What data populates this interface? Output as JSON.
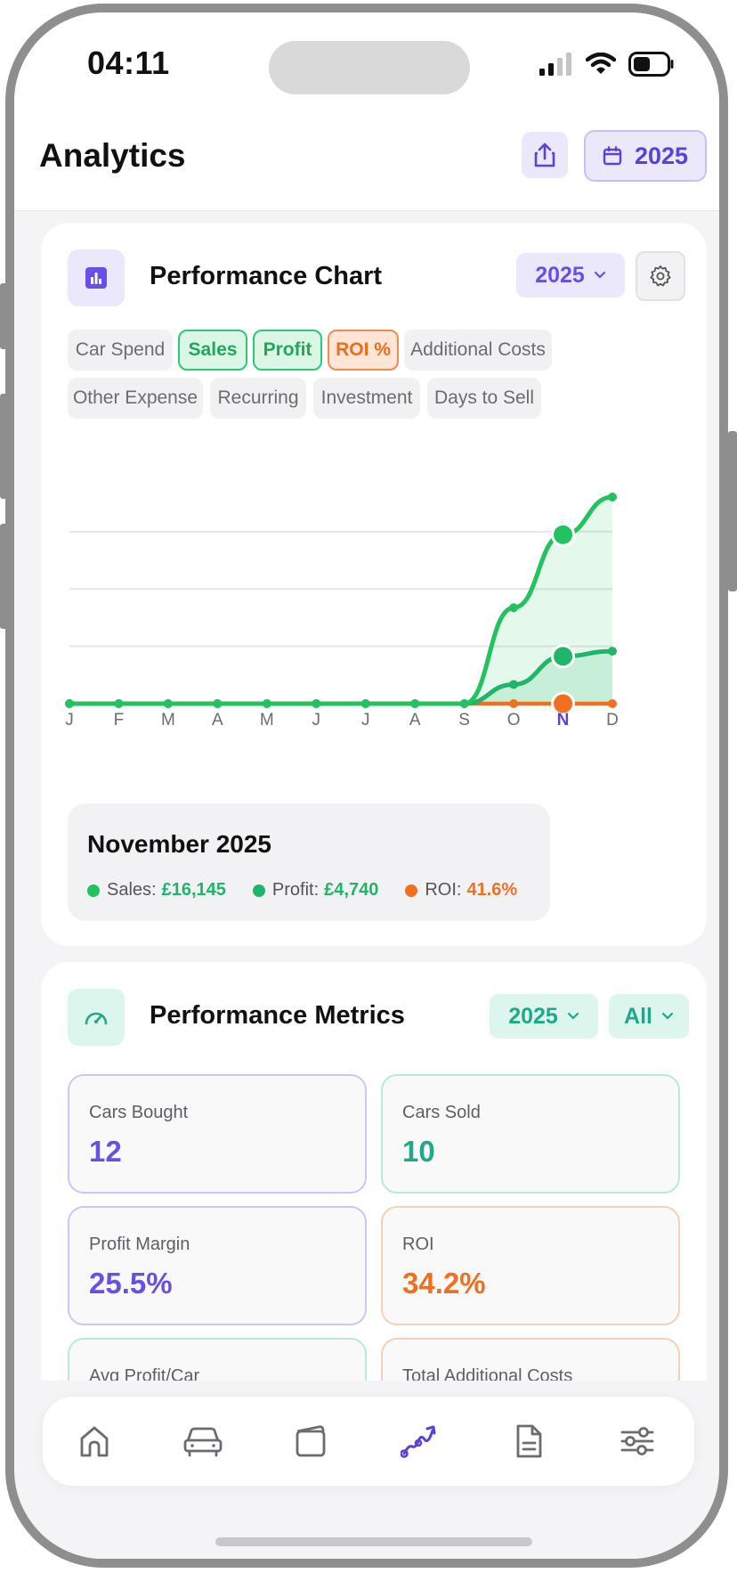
{
  "status_bar": {
    "time": "04:11"
  },
  "header": {
    "title": "Analytics",
    "year": "2025"
  },
  "performance_chart": {
    "title": "Performance Chart",
    "year_dropdown": "2025",
    "chips": [
      {
        "label": "Car Spend",
        "state": "inactive"
      },
      {
        "label": "Sales",
        "state": "active-green"
      },
      {
        "label": "Profit",
        "state": "active-green"
      },
      {
        "label": "ROI %",
        "state": "active-orange"
      },
      {
        "label": "Additional Costs",
        "state": "inactive"
      },
      {
        "label": "Other Expense",
        "state": "inactive"
      },
      {
        "label": "Recurring",
        "state": "inactive"
      },
      {
        "label": "Investment",
        "state": "inactive"
      },
      {
        "label": "Days to Sell",
        "state": "inactive"
      }
    ],
    "tooltip": {
      "title": "November 2025",
      "sales_label": "Sales: ",
      "sales_value": "£16,145",
      "profit_label": "Profit: ",
      "profit_value": "£4,740",
      "roi_label": "ROI: ",
      "roi_value": "41.6%"
    },
    "colors": {
      "sales": "#22c35e",
      "profit": "#1fb56a",
      "roi": "#f07020",
      "selected_month": "#5b42d6"
    }
  },
  "chart_data": {
    "type": "line",
    "categories": [
      "J",
      "F",
      "M",
      "A",
      "M",
      "J",
      "J",
      "A",
      "S",
      "O",
      "N",
      "D"
    ],
    "selected_index": 10,
    "series": [
      {
        "name": "Sales",
        "values": [
          0,
          0,
          0,
          0,
          0,
          0,
          0,
          0,
          0,
          7500,
          13200,
          16145
        ]
      },
      {
        "name": "Profit",
        "values": [
          0,
          0,
          0,
          0,
          0,
          0,
          0,
          0,
          0,
          1500,
          3700,
          4100
        ]
      },
      {
        "name": "ROI %",
        "values": [
          0,
          0,
          0,
          0,
          0,
          0,
          0,
          0,
          0,
          0,
          0,
          0
        ]
      }
    ],
    "ylim": [
      0,
      16145
    ],
    "grid": true
  },
  "performance_metrics": {
    "title": "Performance Metrics",
    "year_dropdown": "2025",
    "filter_dropdown": "All",
    "metrics": [
      {
        "label": "Cars Bought",
        "value": "12"
      },
      {
        "label": "Cars Sold",
        "value": "10"
      },
      {
        "label": "Profit Margin",
        "value": "25.5%"
      },
      {
        "label": "ROI",
        "value": "34.2%"
      },
      {
        "label": "Avg Profit/Car",
        "value": ""
      },
      {
        "label": "Total Additional Costs",
        "value": ""
      }
    ]
  },
  "nav": {
    "items": [
      "home-icon",
      "car-icon",
      "wallet-icon",
      "analytics-icon",
      "document-icon",
      "settings-sliders-icon"
    ],
    "active": "analytics-icon"
  }
}
